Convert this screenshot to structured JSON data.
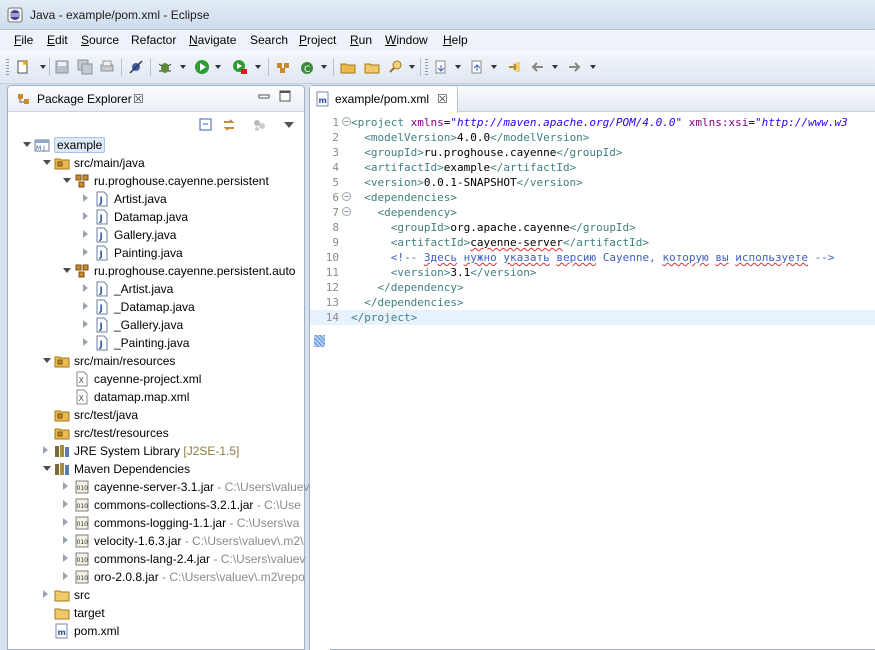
{
  "window": {
    "title": "Java - example/pom.xml - Eclipse"
  },
  "menu": [
    {
      "label": "File",
      "key": "F",
      "rest": "ile"
    },
    {
      "label": "Edit",
      "key": "E",
      "rest": "dit"
    },
    {
      "label": "Source",
      "key": "S",
      "rest": "ource"
    },
    {
      "label": "Refactor",
      "key": "",
      "rest": "Refactor"
    },
    {
      "label": "Navigate",
      "key": "N",
      "rest": "avigate"
    },
    {
      "label": "Search",
      "key": "",
      "rest": "Search"
    },
    {
      "label": "Project",
      "key": "P",
      "rest": "roject"
    },
    {
      "label": "Run",
      "key": "R",
      "rest": "un"
    },
    {
      "label": "Window",
      "key": "W",
      "rest": "indow"
    },
    {
      "label": "Help",
      "key": "H",
      "rest": "elp"
    }
  ],
  "explorer": {
    "tab_label": "Package Explorer",
    "tab_close": "☒",
    "tree": [
      {
        "name": "example",
        "icon": "project-icon",
        "twisty": "open",
        "selected": true
      },
      {
        "name": "src/main/java",
        "icon": "source-folder-icon",
        "twisty": "open"
      },
      {
        "name": "ru.proghouse.cayenne.persistent",
        "icon": "package-icon",
        "twisty": "open"
      },
      {
        "name": "Artist.java",
        "icon": "java-file-icon",
        "twisty": "closed"
      },
      {
        "name": "Datamap.java",
        "icon": "java-file-icon",
        "twisty": "closed"
      },
      {
        "name": "Gallery.java",
        "icon": "java-file-icon",
        "twisty": "closed"
      },
      {
        "name": "Painting.java",
        "icon": "java-file-icon",
        "twisty": "closed"
      },
      {
        "name": "ru.proghouse.cayenne.persistent.auto",
        "icon": "package-icon",
        "twisty": "open"
      },
      {
        "name": "_Artist.java",
        "icon": "java-file-icon",
        "twisty": "closed"
      },
      {
        "name": "_Datamap.java",
        "icon": "java-file-icon",
        "twisty": "closed"
      },
      {
        "name": "_Gallery.java",
        "icon": "java-file-icon",
        "twisty": "closed"
      },
      {
        "name": "_Painting.java",
        "icon": "java-file-icon",
        "twisty": "closed"
      },
      {
        "name": "src/main/resources",
        "icon": "source-folder-icon",
        "twisty": "open"
      },
      {
        "name": "cayenne-project.xml",
        "icon": "xml-file-icon",
        "twisty": "none"
      },
      {
        "name": "datamap.map.xml",
        "icon": "xml-file-icon",
        "twisty": "none"
      },
      {
        "name": "src/test/java",
        "icon": "source-folder-icon",
        "twisty": "none"
      },
      {
        "name": "src/test/resources",
        "icon": "source-folder-icon",
        "twisty": "none"
      },
      {
        "name": "JRE System Library",
        "suffix": "[J2SE-1.5]",
        "icon": "library-icon",
        "twisty": "closed"
      },
      {
        "name": "Maven Dependencies",
        "icon": "library-icon",
        "twisty": "open"
      },
      {
        "name": "cayenne-server-3.1.jar",
        "suffix": "- C:\\Users\\valuev",
        "icon": "jar-icon",
        "twisty": "closed"
      },
      {
        "name": "commons-collections-3.2.1.jar",
        "suffix": "- C:\\Use",
        "icon": "jar-icon",
        "twisty": "closed"
      },
      {
        "name": "commons-logging-1.1.jar",
        "suffix": "- C:\\Users\\va",
        "icon": "jar-icon",
        "twisty": "closed"
      },
      {
        "name": "velocity-1.6.3.jar",
        "suffix": "- C:\\Users\\valuev\\.m2\\",
        "icon": "jar-icon",
        "twisty": "closed"
      },
      {
        "name": "commons-lang-2.4.jar",
        "suffix": "- C:\\Users\\valuev",
        "icon": "jar-icon",
        "twisty": "closed"
      },
      {
        "name": "oro-2.0.8.jar",
        "suffix": "- C:\\Users\\valuev\\.m2\\repo",
        "icon": "jar-icon",
        "twisty": "closed"
      },
      {
        "name": "src",
        "icon": "folder-icon",
        "twisty": "closed"
      },
      {
        "name": "target",
        "icon": "folder-icon",
        "twisty": "none"
      },
      {
        "name": "pom.xml",
        "icon": "maven-file-icon",
        "twisty": "none"
      }
    ]
  },
  "editor": {
    "tab_label": "example/pom.xml",
    "tab_close": "☒",
    "lines": [
      {
        "n": "1",
        "fold": "−"
      },
      {
        "n": "2"
      },
      {
        "n": "3"
      },
      {
        "n": "4"
      },
      {
        "n": "5"
      },
      {
        "n": "6",
        "fold": "−"
      },
      {
        "n": "7",
        "fold": "−"
      },
      {
        "n": "8"
      },
      {
        "n": "9"
      },
      {
        "n": "10"
      },
      {
        "n": "11"
      },
      {
        "n": "12"
      },
      {
        "n": "13"
      },
      {
        "n": "14"
      }
    ],
    "code": {
      "l1_open": "<project ",
      "l1_attr1": "xmlns",
      "l1_eq1": "=",
      "l1_val1": "\"http://maven.apache.org/POM/4.0.0\"",
      "l1_attr2": " xmlns:xsi",
      "l1_eq2": "=",
      "l1_val2": "\"http://www.w3",
      "l2_open": "<modelVersion>",
      "l2_text": "4.0.0",
      "l2_close": "</modelVersion>",
      "l3_open": "<groupId>",
      "l3_text": "ru.proghouse.cayenne",
      "l3_close": "</groupId>",
      "l4_open": "<artifactId>",
      "l4_text": "example",
      "l4_close": "</artifactId>",
      "l5_open": "<version>",
      "l5_text": "0.0.1-SNAPSHOT",
      "l5_close": "</version>",
      "l6_open": "<dependencies>",
      "l7_open": "<dependency>",
      "l8_open": "<groupId>",
      "l8_text": "org.apache.cayenne",
      "l8_close": "</groupId>",
      "l9_open": "<artifactId>",
      "l9_text": "cayenne-server",
      "l9_close": "</artifactId>",
      "l10_c1": "<!-- ",
      "l10_w1": "Здесь",
      "l10_s1": " ",
      "l10_w2": "нужно",
      "l10_s2": " ",
      "l10_w3": "указать",
      "l10_s3": " ",
      "l10_w4": "версию",
      "l10_s4": " Cayenne, ",
      "l10_w5": "которую",
      "l10_s5": " ",
      "l10_w6": "вы",
      "l10_s6": " ",
      "l10_w7": "используете",
      "l10_c2": " -->",
      "l11_open": "<version>",
      "l11_text": "3.1",
      "l11_close": "</version>",
      "l12_close": "</dependency>",
      "l13_close": "</dependencies>",
      "l14_close": "</project>"
    }
  },
  "colors": {
    "tag": "#3f7f7f",
    "attr": "#7f007f",
    "value": "#2a00ff",
    "comment": "#3f5fbf"
  }
}
